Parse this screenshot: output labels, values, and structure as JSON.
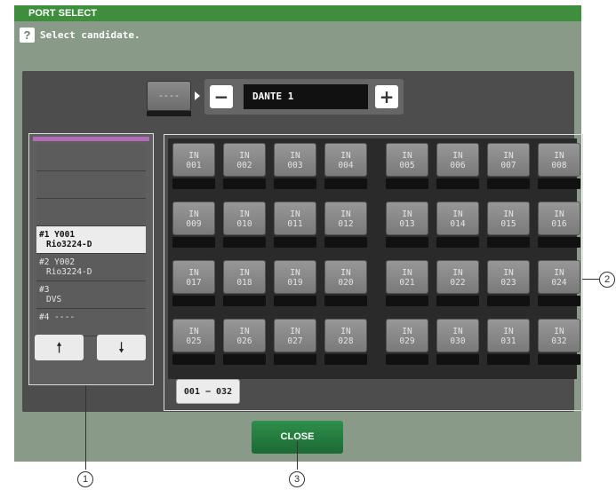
{
  "window": {
    "title": "PORT SELECT"
  },
  "help": {
    "icon": "help-icon",
    "text": "Select candidate."
  },
  "source_button": {
    "label": "----"
  },
  "device_name": {
    "minus_label": "−",
    "value": "DANTE 1",
    "plus_label": "+"
  },
  "device_list": {
    "items": [
      {
        "line1": "",
        "line2": ""
      },
      {
        "line1": "",
        "line2": ""
      },
      {
        "line1": "",
        "line2": ""
      },
      {
        "line1": "#1 Y001",
        "line2": "Rio3224-D",
        "selected": true
      },
      {
        "line1": "#2 Y002",
        "line2": "Rio3224-D"
      },
      {
        "line1": "#3",
        "line2": "DVS"
      },
      {
        "line1": "#4 ----",
        "line2": ""
      }
    ],
    "up_icon": "arrow-up-icon",
    "down_icon": "arrow-down-icon",
    "up_label": "🠕",
    "down_label": "🠗"
  },
  "channels": {
    "prefix": "IN",
    "numbers": [
      "001",
      "002",
      "003",
      "004",
      "005",
      "006",
      "007",
      "008",
      "009",
      "010",
      "011",
      "012",
      "013",
      "014",
      "015",
      "016",
      "017",
      "018",
      "019",
      "020",
      "021",
      "022",
      "023",
      "024",
      "025",
      "026",
      "027",
      "028",
      "029",
      "030",
      "031",
      "032"
    ]
  },
  "page_tab": {
    "label": "001 − 032"
  },
  "close_button": {
    "label": "CLOSE"
  },
  "callouts": {
    "c1": "1",
    "c2": "2",
    "c3": "3"
  },
  "colors": {
    "titlebar": "#3e8e3e",
    "close": "#2e8f4a",
    "list_accent": "#b36cb7"
  }
}
